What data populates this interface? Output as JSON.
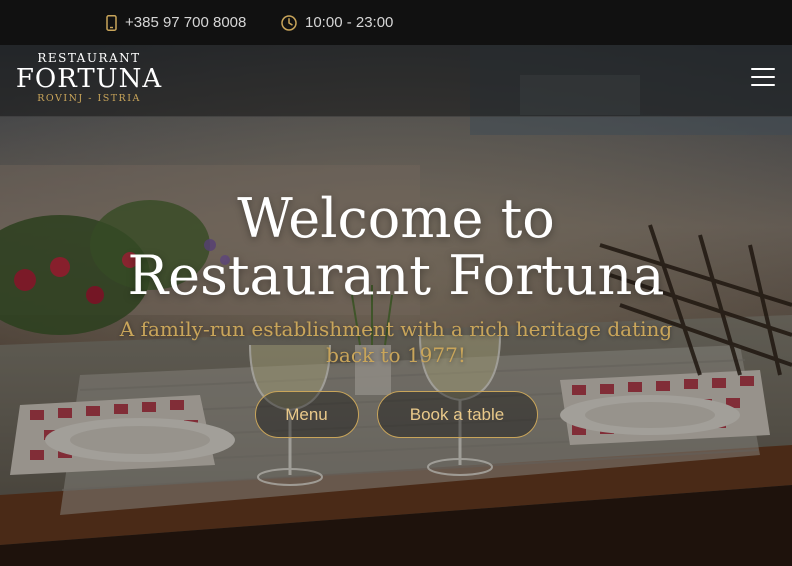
{
  "topbar": {
    "phone": {
      "icon": "phone-icon",
      "text": "+385 97 700 8008"
    },
    "hours": {
      "icon": "clock-icon",
      "text": "10:00 - 23:00"
    }
  },
  "logo": {
    "top": "RESTAURANT",
    "main": "FORTUNA",
    "sub": "ROVINJ - ISTRIA"
  },
  "nav": {
    "menu_icon": "hamburger-menu-icon"
  },
  "hero": {
    "title_line1": "Welcome to",
    "title_line2": "Restaurant Fortuna",
    "subtitle": "A family-run establishment with a rich heritage dating back to 1977!",
    "buttons": {
      "menu": "Menu",
      "book": "Book a table"
    }
  },
  "colors": {
    "accent_gold": "#c9a55a",
    "topbar_bg": "#111111",
    "title_text": "#ffffff"
  }
}
